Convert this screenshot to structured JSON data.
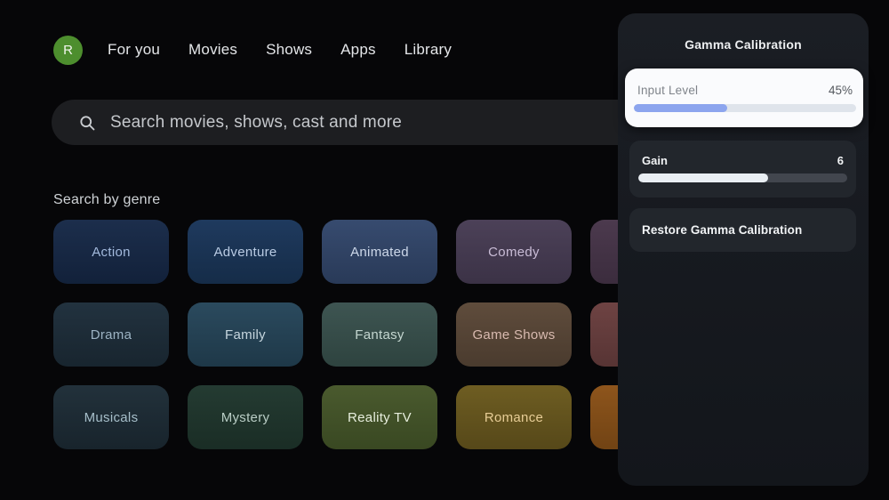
{
  "nav": {
    "avatar_letter": "R",
    "avatar_color": "#4d8e2e",
    "items": [
      {
        "label": "For you"
      },
      {
        "label": "Movies"
      },
      {
        "label": "Shows"
      },
      {
        "label": "Apps"
      },
      {
        "label": "Library"
      }
    ]
  },
  "search": {
    "placeholder": "Search movies, shows, cast and more",
    "icon": "search-icon",
    "icon_color": "#c9ccd0"
  },
  "genre_section": {
    "heading": "Search by genre",
    "tiles": [
      {
        "label": "Action",
        "bg_top": "#1c2e4c",
        "bg_bottom": "#12213a",
        "text_color": "#a3badd"
      },
      {
        "label": "Adventure",
        "bg_top": "#1f3a5e",
        "bg_bottom": "#152c48",
        "text_color": "#b9cbe3"
      },
      {
        "label": "Animated",
        "bg_top": "#374b6f",
        "bg_bottom": "#293a58",
        "text_color": "#cdd8ea"
      },
      {
        "label": "Comedy",
        "bg_top": "#4c4158",
        "bg_bottom": "#3b3246",
        "text_color": "#c9bcd6"
      },
      {
        "label": "",
        "bg_top": "#4c3a4e",
        "bg_bottom": "#3b2c3d",
        "text_color": "#cfc2d8"
      },
      {
        "label": "Drama",
        "bg_top": "#22323f",
        "bg_bottom": "#18252f",
        "text_color": "#9db3c4"
      },
      {
        "label": "Family",
        "bg_top": "#2b4a5e",
        "bg_bottom": "#1e3848",
        "text_color": "#c6d6de"
      },
      {
        "label": "Fantasy",
        "bg_top": "#3e5552",
        "bg_bottom": "#2e433f",
        "text_color": "#c4d6d0"
      },
      {
        "label": "Game Shows",
        "bg_top": "#5f4c3c",
        "bg_bottom": "#4a3b2e",
        "text_color": "#d9bab0"
      },
      {
        "label": "",
        "bg_top": "#6e4343",
        "bg_bottom": "#573434",
        "text_color": "#dcc0ba"
      },
      {
        "label": "Musicals",
        "bg_top": "#22313b",
        "bg_bottom": "#18242c",
        "text_color": "#a7bfca"
      },
      {
        "label": "Mystery",
        "bg_top": "#243b32",
        "bg_bottom": "#1a2d25",
        "text_color": "#b9cdc5"
      },
      {
        "label": "Reality TV",
        "bg_top": "#4a5a2e",
        "bg_bottom": "#394822",
        "text_color": "#e7eedd"
      },
      {
        "label": "Romance",
        "bg_top": "#6e5d22",
        "bg_bottom": "#564819",
        "text_color": "#e7cd96"
      },
      {
        "label": "",
        "bg_top": "#8e551c",
        "bg_bottom": "#714314",
        "text_color": "#ecd0ae"
      }
    ]
  },
  "gamma_panel": {
    "title": "Gamma Calibration",
    "input_level": {
      "label": "Input Level",
      "value_text": "45%",
      "fill_percent": 42,
      "fill_color": "#8ca5ee",
      "track_color": "#dfe4eb"
    },
    "gain": {
      "label": "Gain",
      "value_text": "6",
      "fill_percent": 62,
      "fill_color": "#e9eef3",
      "track_color": "#42464e"
    },
    "restore_label": "Restore Gamma Calibration"
  }
}
